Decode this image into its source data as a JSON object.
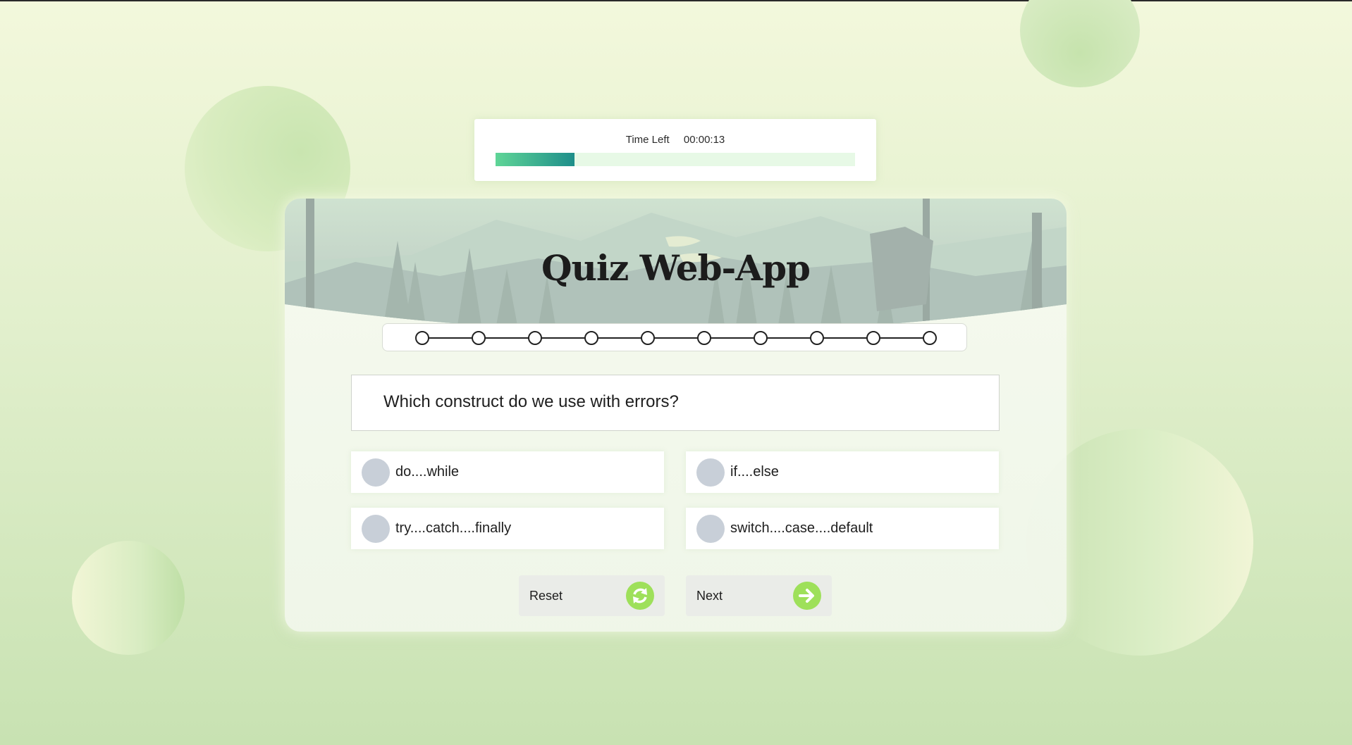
{
  "timer": {
    "label": "Time Left",
    "value": "00:00:13",
    "progress_fraction": 0.22,
    "colors": {
      "start": "#5fd597",
      "end": "#1e8e8a",
      "track": "#e7f9e6"
    }
  },
  "header": {
    "title": "Quiz Web-App"
  },
  "steps": {
    "total": 10
  },
  "question": {
    "text": "Which construct do we use with errors?"
  },
  "options": [
    {
      "label": "do....while"
    },
    {
      "label": "if....else"
    },
    {
      "label": "try....catch....finally"
    },
    {
      "label": "switch....case....default"
    }
  ],
  "buttons": {
    "reset": {
      "label": "Reset",
      "icon": "refresh-icon"
    },
    "next": {
      "label": "Next",
      "icon": "arrow-right-icon"
    },
    "accent": "#9ee05a"
  }
}
